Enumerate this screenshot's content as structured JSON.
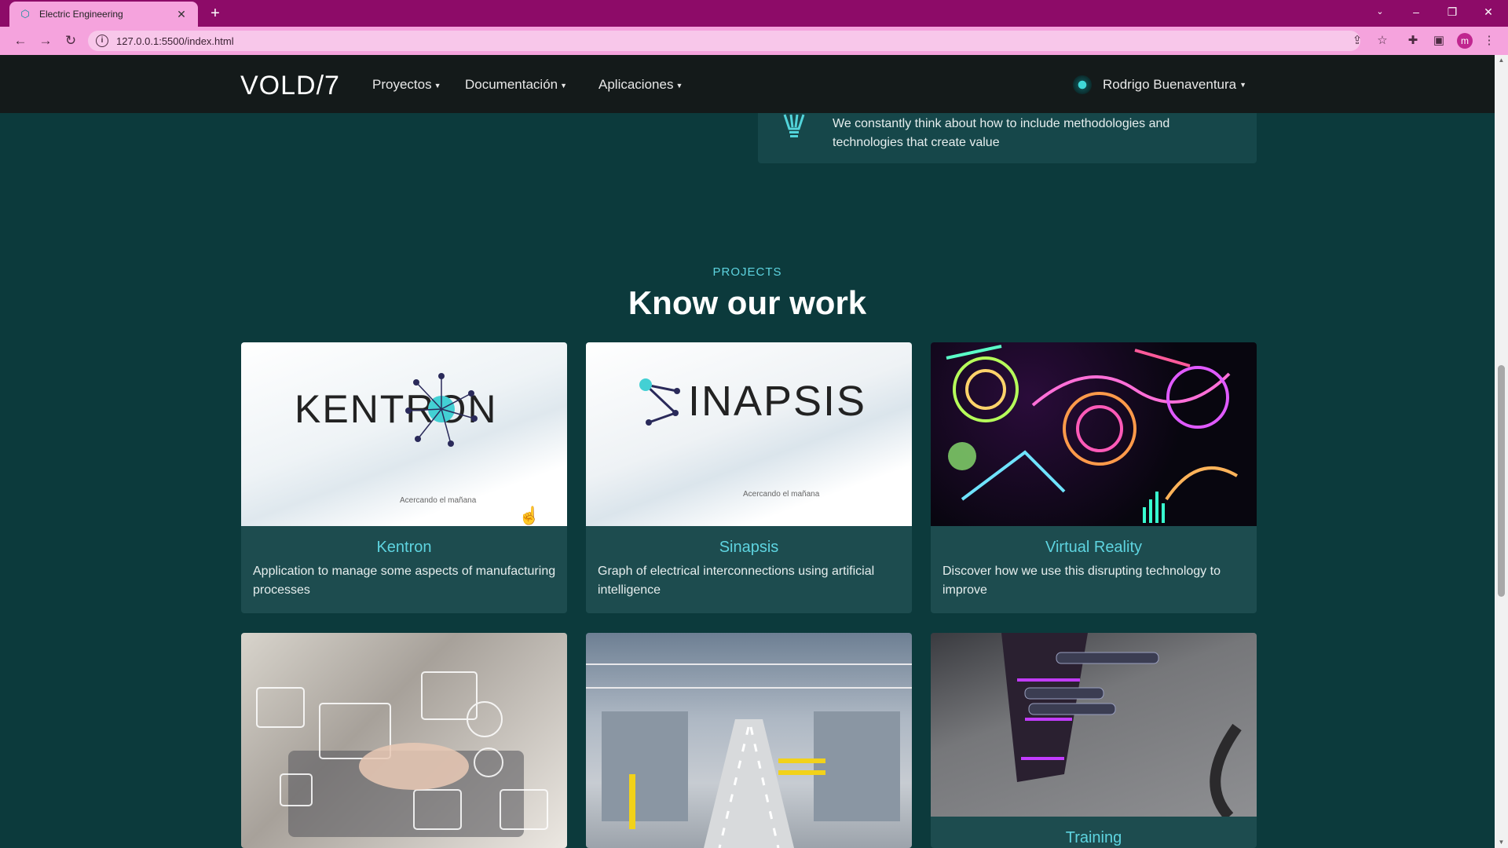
{
  "browser": {
    "tab_title": "Electric Engineering",
    "url": "127.0.0.1:5500/index.html",
    "profile_initial": "m"
  },
  "navbar": {
    "logo": "VOLD/7",
    "menu": [
      "Proyectos",
      "Documentación",
      "Aplicaciones"
    ],
    "user_name": "Rodrigo Buenaventura"
  },
  "info_card": {
    "text": "We constantly think about how to include methodologies and technologies that create value"
  },
  "projects": {
    "label": "PROJECTS",
    "title": "Know our work",
    "cards": [
      {
        "title": "Kentron",
        "description": "Application to manage some aspects of manufacturing processes",
        "brand": "KENTRON",
        "tagline": "Acercando el mañana"
      },
      {
        "title": "Sinapsis",
        "description": "Graph of electrical interconnections using artificial intelligence",
        "brand": "INAPSIS",
        "tagline": "Acercando el mañana"
      },
      {
        "title": "Virtual Reality",
        "description": "Discover how we use this disrupting technology to improve"
      },
      {
        "title": "",
        "description": ""
      },
      {
        "title": "",
        "description": ""
      },
      {
        "title": "Training",
        "description": ""
      }
    ]
  },
  "colors": {
    "page_bg": "#0c3a3c",
    "accent": "#5ed4e0",
    "browser_frame": "#8d0b68",
    "browser_toolbar": "#f5a3dd"
  }
}
